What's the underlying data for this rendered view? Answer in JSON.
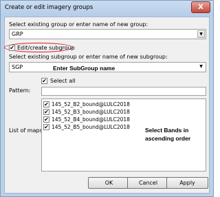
{
  "window": {
    "title": "Create or edit imagery groups",
    "close_glyph": "X"
  },
  "group": {
    "label": "Select existing group or enter name of new group:",
    "value": "GRP"
  },
  "subgroup_toggle": {
    "label": "Edit/create subgroup",
    "checked": true
  },
  "subgroup": {
    "label": "Select existing subgroup or enter name of new subgroup:",
    "value": "SGP"
  },
  "annotations": {
    "subgroup_hint": "Enter SubGroup name",
    "bands_hint_line1": "Select Bands in",
    "bands_hint_line2": "ascending order"
  },
  "select_all": {
    "label": "Select all",
    "checked": true
  },
  "pattern": {
    "label": "Pattern:",
    "value": ""
  },
  "maps": {
    "label": "List of maps:",
    "items": [
      {
        "name": "145_52_B2_bound@LULC2018",
        "checked": true
      },
      {
        "name": "145_52_B3_bound@LULC2018",
        "checked": true
      },
      {
        "name": "145_52_B4_bound@LULC2018",
        "checked": true
      },
      {
        "name": "145_52_B5_bound@LULC2018",
        "checked": true
      }
    ]
  },
  "buttons": {
    "ok": "OK",
    "cancel": "Cancel",
    "apply": "Apply"
  },
  "colors": {
    "highlight": "#e01b1b",
    "titlebar": "#b6cde6"
  },
  "icons": {
    "dropdown": "chevron-down-icon",
    "check": "check-icon",
    "close": "close-icon"
  }
}
